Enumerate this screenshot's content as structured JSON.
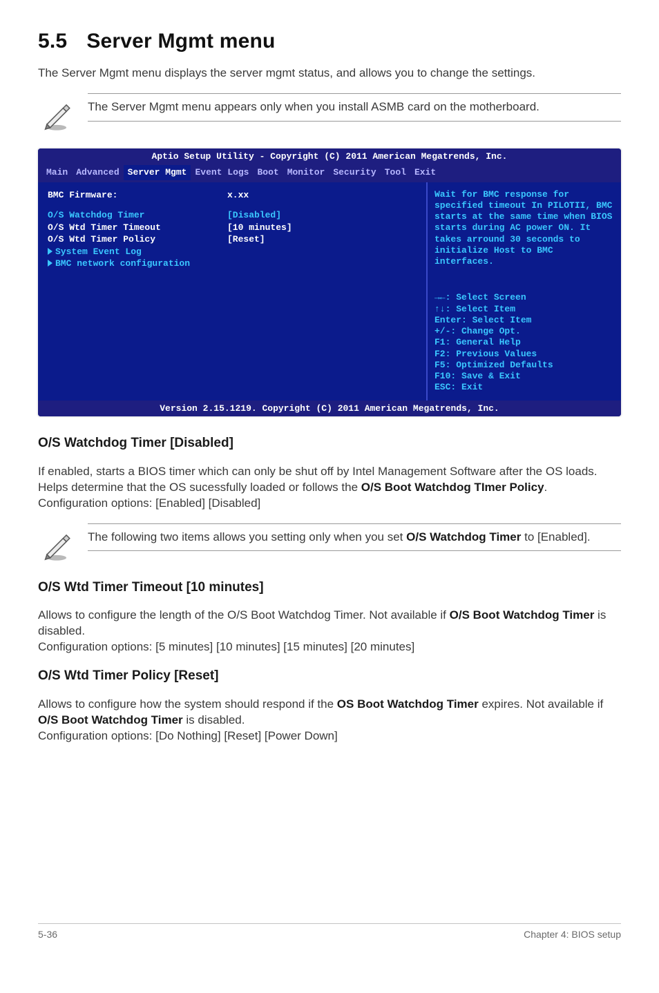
{
  "section": {
    "number": "5.5",
    "title": "Server Mgmt menu"
  },
  "intro": "The Server Mgmt menu displays the server mgmt status, and allows you to change the settings.",
  "note1": "The Server Mgmt menu appears only when you install ASMB card on the motherboard.",
  "bios": {
    "top": "Aptio Setup Utility - Copyright (C) 2011 American Megatrends, Inc.",
    "tabs": {
      "main": "Main",
      "advanced": "Advanced",
      "server": "Server Mgmt",
      "event": "Event Logs",
      "boot": "Boot",
      "monitor": "Monitor",
      "security": "Security",
      "tool": "Tool",
      "exit": "Exit"
    },
    "rows": {
      "fw_label": "BMC Firmware:",
      "fw_val": "x.xx",
      "wdt_label": "O/S Watchdog Timer",
      "wdt_val": "[Disabled]",
      "tt_label": "O/S Wtd Timer Timeout",
      "tt_val": "[10 minutes]",
      "tp_label": "O/S Wtd Timer Policy",
      "tp_val": "[Reset]",
      "sel": "System Event Log",
      "net": "BMC network configuration"
    },
    "help_top": "Wait for BMC response for specified timeout In PILOTII, BMC starts at the same time when BIOS starts during AC power ON. It takes arround 30 seconds to initialize Host to BMC interfaces.",
    "help_keys": {
      "l1": "→←: Select Screen",
      "l2": "↑↓:  Select Item",
      "l3": "Enter: Select Item",
      "l4": "+/-: Change Opt.",
      "l5": "F1: General Help",
      "l6": "F2: Previous Values",
      "l7": "F5: Optimized Defaults",
      "l8": "F10: Save & Exit",
      "l9": "ESC: Exit"
    },
    "foot": "Version 2.15.1219. Copyright (C) 2011 American Megatrends, Inc."
  },
  "wdt": {
    "head": "O/S Watchdog Timer [Disabled]",
    "body_pre": "If enabled, starts a BIOS timer which can only be shut off by Intel Management Software after the OS loads. Helps determine that the OS sucessfully loaded or follows the ",
    "body_bold": "O/S Boot Watchdog TImer Policy",
    "body_post": ".",
    "opts": "Configuration options: [Enabled] [Disabled]"
  },
  "note2_pre": "The following two items allows you setting only when you set ",
  "note2_b1": "O/S Watchdog Timer",
  "note2_mid": " to [Enabled].",
  "tt": {
    "head": "O/S Wtd Timer Timeout [10 minutes]",
    "body_pre": "Allows to configure the length of the O/S Boot Watchdog Timer. Not available if ",
    "body_bold": "O/S Boot Watchdog Timer",
    "body_post": " is disabled.",
    "opts": "Configuration options: [5 minutes] [10 minutes] [15 minutes] [20 minutes]"
  },
  "tp": {
    "head": "O/S Wtd Timer Policy [Reset]",
    "body_pre": "Allows to configure how the system should respond if the ",
    "body_b1": "OS Boot Watchdog Timer",
    "body_mid": " expires. Not available if ",
    "body_b2": "O/S Boot Watchdog Timer",
    "body_post": " is disabled.",
    "opts": "Configuration options: [Do Nothing] [Reset] [Power Down]"
  },
  "footer": {
    "left": "5-36",
    "right": "Chapter 4: BIOS setup"
  }
}
